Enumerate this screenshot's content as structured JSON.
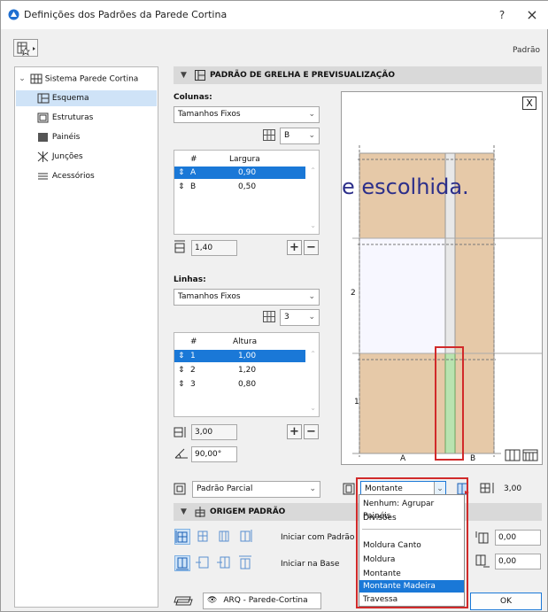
{
  "window": {
    "title": "Definições dos Padrões da Parede Cortina",
    "help_label": "?",
    "close_label": "×",
    "preset_label": "Padrão"
  },
  "sidebar": {
    "root_label": "Sistema Parede Cortina",
    "items": [
      {
        "label": "Esquema",
        "icon": "grid-scheme-icon",
        "selected": true
      },
      {
        "label": "Estruturas",
        "icon": "frame-icon",
        "selected": false
      },
      {
        "label": "Painéis",
        "icon": "panel-icon",
        "selected": false
      },
      {
        "label": "Junções",
        "icon": "junction-icon",
        "selected": false
      },
      {
        "label": "Acessórios",
        "icon": "accessory-icon",
        "selected": false
      }
    ]
  },
  "grid_section": {
    "header": "PADRÃO DE GRELHA E PREVISUALIZAÇÃO",
    "columns": {
      "label": "Colunas:",
      "mode": "Tamanhos Fixos",
      "pattern_letter": "B",
      "table_headers": [
        "#",
        "Largura"
      ],
      "rows": [
        {
          "id": "A",
          "value": "0,90",
          "selected": true
        },
        {
          "id": "B",
          "value": "0,50",
          "selected": false
        }
      ],
      "total": "1,40"
    },
    "rows_block": {
      "label": "Linhas:",
      "mode": "Tamanhos Fixos",
      "pattern_count": "3",
      "table_headers": [
        "#",
        "Altura"
      ],
      "rows": [
        {
          "id": "1",
          "value": "1,00",
          "selected": true
        },
        {
          "id": "2",
          "value": "1,20",
          "selected": false
        },
        {
          "id": "3",
          "value": "0,80",
          "selected": false
        }
      ],
      "total": "3,00",
      "angle": "90,00°"
    },
    "plus_label": "+",
    "minus_label": "−"
  },
  "preview": {
    "overlay_text": "e escolhida.",
    "row_labels": [
      "2",
      "1"
    ],
    "col_labels": [
      "A",
      "B"
    ],
    "close_label": "X"
  },
  "pattern_bar": {
    "pattern_mode": "Padrão Parcial",
    "member_type": "Montante",
    "height_value": "3,00"
  },
  "member_dropdown": {
    "options": [
      {
        "label": "Nenhum: Agrupar Painéis",
        "selected": false
      },
      {
        "label": "Divisões",
        "selected": false
      },
      {
        "label": "Moldura Canto",
        "selected": false
      },
      {
        "label": "Moldura",
        "selected": false
      },
      {
        "label": "Montante",
        "selected": false
      },
      {
        "label": "Montante Madeira",
        "selected": true
      },
      {
        "label": "Travessa",
        "selected": false
      }
    ]
  },
  "origin_section": {
    "header": "ORIGEM PADRÃO",
    "start_with_pattern": "Iniciar com Padrão",
    "start_at_base": "Iniciar na Base",
    "offset_x": "0,00",
    "offset_y": "0,00"
  },
  "footer": {
    "layer": "ARQ - Parede-Cortina",
    "ok_label": "OK"
  },
  "colors": {
    "panel_fill": "#e6c9a8",
    "selected_blue": "#1a78d7",
    "highlight_red": "#d12a2a",
    "mullion_green": "#b9e3b0"
  }
}
